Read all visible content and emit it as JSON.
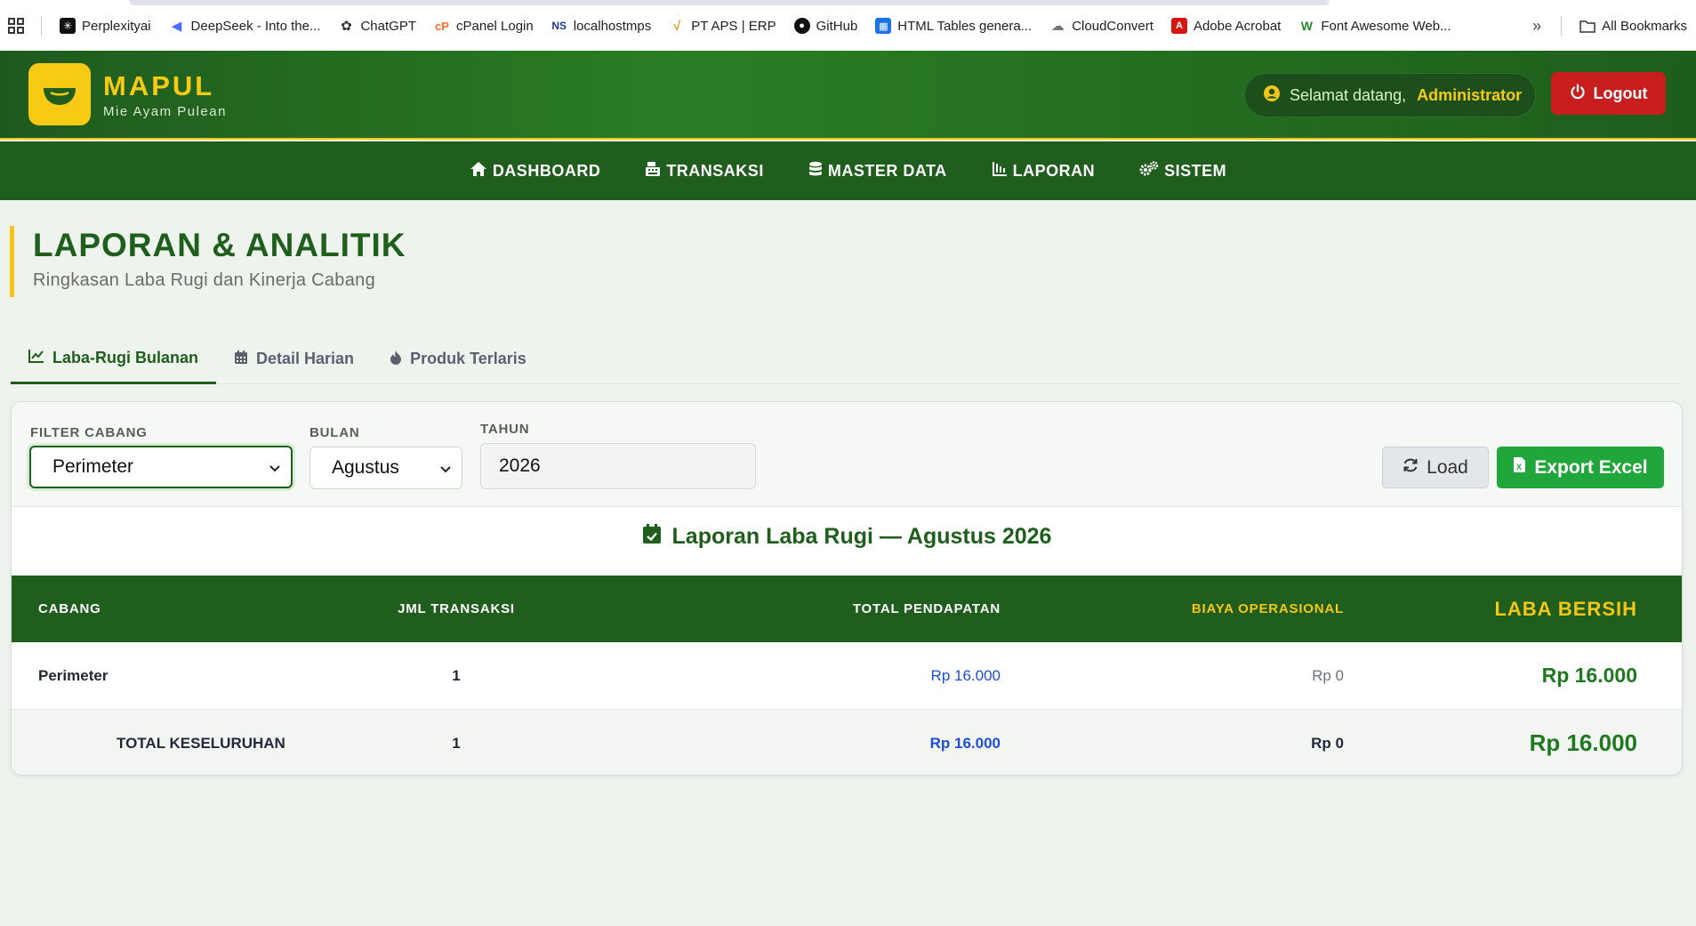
{
  "bookmarks": {
    "items": [
      {
        "label": "Perplexityai",
        "icon": "perplexity-icon"
      },
      {
        "label": "DeepSeek - Into the...",
        "icon": "deepseek-icon"
      },
      {
        "label": "ChatGPT",
        "icon": "chatgpt-icon"
      },
      {
        "label": "cPanel Login",
        "icon": "cpanel-icon"
      },
      {
        "label": "localhostmps",
        "icon": "localhost-icon"
      },
      {
        "label": "PT APS | ERP",
        "icon": "erp-icon"
      },
      {
        "label": "GitHub",
        "icon": "github-icon"
      },
      {
        "label": "HTML Tables genera...",
        "icon": "table-icon"
      },
      {
        "label": "CloudConvert",
        "icon": "cloudconvert-icon"
      },
      {
        "label": "Adobe Acrobat",
        "icon": "acrobat-icon"
      },
      {
        "label": "Font Awesome Web...",
        "icon": "fontawesome-icon"
      }
    ],
    "all_bookmarks": "All Bookmarks"
  },
  "header": {
    "brand_title": "MAPUL",
    "brand_subtitle": "Mie Ayam Pulean",
    "welcome_text": "Selamat datang,",
    "user_name": "Administrator",
    "logout_label": "Logout"
  },
  "nav": {
    "items": [
      {
        "label": "DASHBOARD",
        "icon": "home-icon"
      },
      {
        "label": "TRANSAKSI",
        "icon": "cash-register-icon"
      },
      {
        "label": "MASTER DATA",
        "icon": "database-icon"
      },
      {
        "label": "LAPORAN",
        "icon": "chart-icon"
      },
      {
        "label": "SISTEM",
        "icon": "gears-icon"
      }
    ]
  },
  "page": {
    "title": "LAPORAN & ANALITIK",
    "subtitle": "Ringkasan Laba Rugi dan Kinerja Cabang"
  },
  "tabs": [
    {
      "label": "Laba-Rugi Bulanan",
      "icon": "line-chart-icon",
      "active": true
    },
    {
      "label": "Detail Harian",
      "icon": "calendar-icon",
      "active": false
    },
    {
      "label": "Produk Terlaris",
      "icon": "fire-icon",
      "active": false
    }
  ],
  "filters": {
    "branch_label": "FILTER CABANG",
    "branch_value": "Perimeter",
    "month_label": "BULAN",
    "month_value": "Agustus",
    "year_label": "TAHUN",
    "year_value": "2026",
    "load_label": "Load",
    "export_label": "Export Excel"
  },
  "report": {
    "title": "Laporan Laba Rugi — Agustus 2026",
    "columns": [
      "CABANG",
      "JML TRANSAKSI",
      "TOTAL PENDAPATAN",
      "BIAYA OPERASIONAL",
      "LABA BERSIH"
    ],
    "rows": [
      {
        "cabang": "Perimeter",
        "jml": "1",
        "pendapatan": "Rp 16.000",
        "biaya": "Rp 0",
        "laba": "Rp 16.000"
      }
    ],
    "total": {
      "label": "TOTAL KESELURUHAN",
      "jml": "1",
      "pendapatan": "Rp 16.000",
      "biaya": "Rp 0",
      "laba": "Rp 16.000"
    }
  },
  "colors": {
    "primary_green": "#1f5e1d",
    "accent_yellow": "#f5c518",
    "logout_red": "#c81e1e",
    "export_green": "#20a63a"
  }
}
